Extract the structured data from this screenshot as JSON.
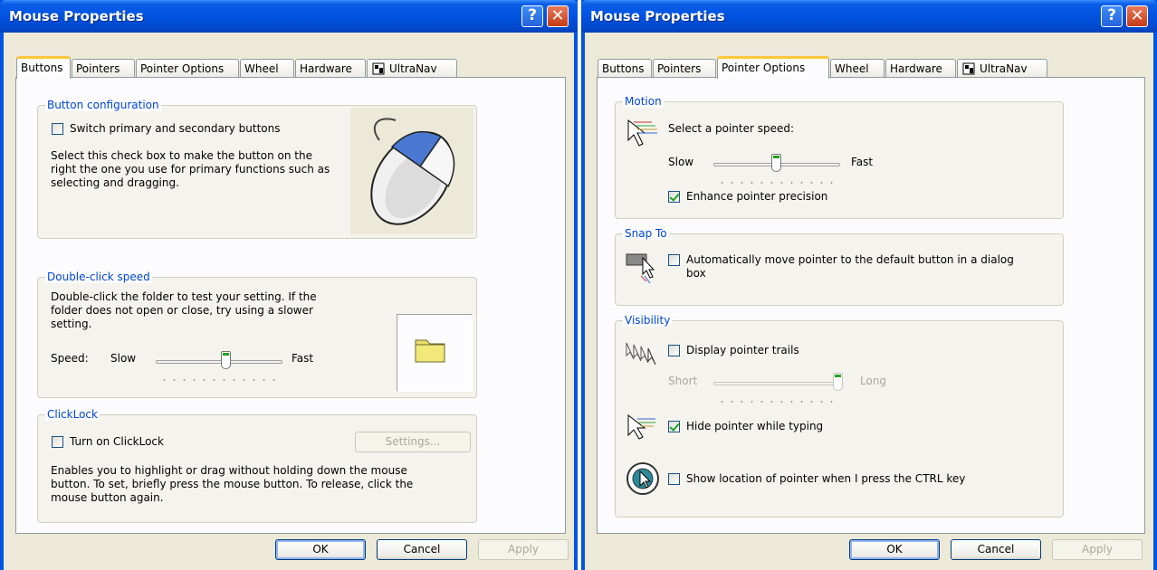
{
  "left_dialog": {
    "title": "Mouse Properties",
    "tabs": [
      "Buttons",
      "Pointers",
      "Pointer Options",
      "Wheel",
      "Hardware",
      "UltraNav"
    ],
    "selected_tab": "Buttons",
    "button_configuration": {
      "label": "Button configuration",
      "checkbox_label": "Switch primary and secondary buttons",
      "checked": false,
      "description": "Select this check box to make the button on the right the one you use for primary functions such as selecting and dragging."
    },
    "double_click": {
      "label": "Double-click speed",
      "description": "Double-click the folder to test your setting. If the folder does not open or close, try using a slower setting.",
      "speed_label": "Speed:",
      "slow_label": "Slow",
      "fast_label": "Fast",
      "value_fraction": 0.6
    },
    "clicklock": {
      "label": "ClickLock",
      "checkbox_label": "Turn on ClickLock",
      "checked": false,
      "settings_button": "Settings...",
      "description": "Enables you to highlight or drag without holding down the mouse button. To set, briefly press the mouse button. To release, click the mouse button again."
    },
    "buttons": {
      "ok": "OK",
      "cancel": "Cancel",
      "apply": "Apply"
    }
  },
  "right_dialog": {
    "title": "Mouse Properties",
    "tabs": [
      "Buttons",
      "Pointers",
      "Pointer Options",
      "Wheel",
      "Hardware",
      "UltraNav"
    ],
    "selected_tab": "Pointer Options",
    "motion": {
      "label": "Motion",
      "prompt": "Select a pointer speed:",
      "slow_label": "Slow",
      "fast_label": "Fast",
      "value_fraction": 0.5,
      "precision_label": "Enhance pointer precision",
      "precision_checked": true
    },
    "snap_to": {
      "label": "Snap To",
      "checkbox_label": "Automatically move pointer to the default button in a dialog box",
      "checked": false
    },
    "visibility": {
      "label": "Visibility",
      "trails_label": "Display pointer trails",
      "trails_checked": false,
      "short_label": "Short",
      "long_label": "Long",
      "trails_value_fraction": 1.0,
      "hide_label": "Hide pointer while typing",
      "hide_checked": true,
      "ctrl_label": "Show location of pointer when I press the CTRL key",
      "ctrl_checked": false
    },
    "buttons": {
      "ok": "OK",
      "cancel": "Cancel",
      "apply": "Apply"
    }
  },
  "colors": {
    "titlebar": "#0054e3",
    "dialog_face": "#ece9d8",
    "group_label": "#0046d5",
    "tab_highlight": "#ffc83c"
  }
}
